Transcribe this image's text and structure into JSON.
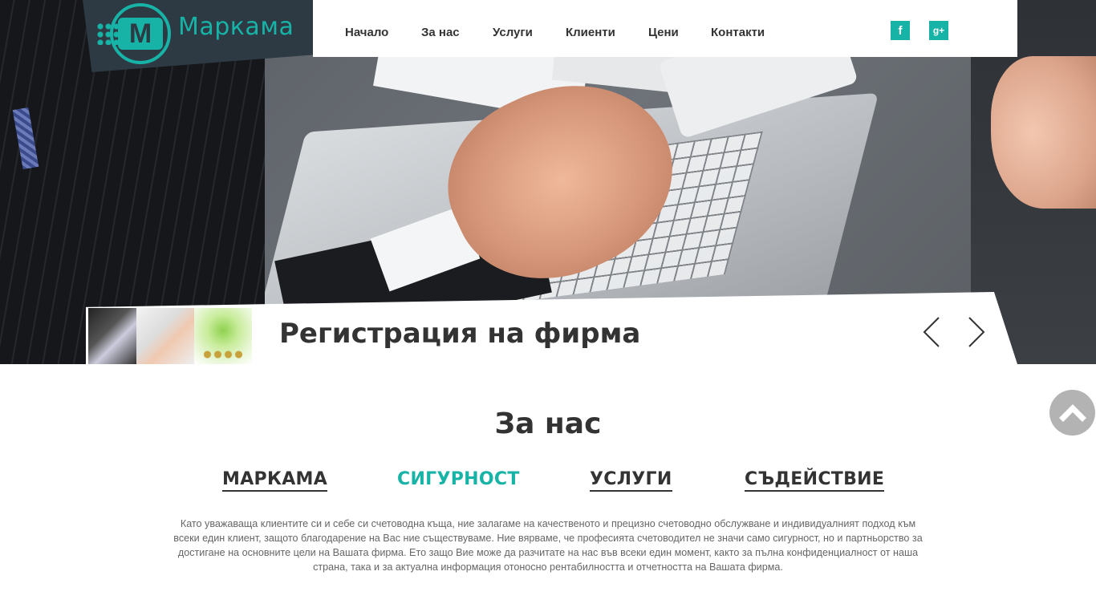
{
  "brand": {
    "name": "Маркама",
    "mark_letter": "M",
    "accent_color": "#17b3a7",
    "dark_color": "#2d3a44"
  },
  "nav": {
    "items": [
      {
        "label": "Начало"
      },
      {
        "label": "За нас"
      },
      {
        "label": "Услуги"
      },
      {
        "label": "Клиенти"
      },
      {
        "label": "Цени"
      },
      {
        "label": "Контакти"
      }
    ]
  },
  "social": {
    "facebook": {
      "icon": "facebook-icon",
      "glyph": "f"
    },
    "googleplus": {
      "icon": "google-plus-icon",
      "glyph": "g+"
    }
  },
  "slider": {
    "title": "Регистрация на фирма",
    "thumbnails": [
      "thumbnail-handshake",
      "thumbnail-documents",
      "thumbnail-plants"
    ],
    "prev_icon": "chevron-left-icon",
    "next_icon": "chevron-right-icon"
  },
  "about": {
    "title": "За нас",
    "tabs": [
      {
        "label": "МАРКАМА",
        "active": false
      },
      {
        "label": "СИГУРНОСТ",
        "active": true
      },
      {
        "label": "УСЛУГИ",
        "active": false
      },
      {
        "label": "СЪДЕЙСТВИЕ",
        "active": false
      }
    ],
    "text": "Като уважаваща клиентите си и себе си счетоводна къща, ние залагаме на качественото и прецизно счетоводно обслужване и индивидуалният подход към всеки един клиент, защото благодарение на Вас ние съществуваме. Ние вярваме, че професията счетоводител не значи само сигурност, но и партньорство за достигане на основните цели на Вашата фирма. Ето защо Вие може да разчитате на нас във всеки един момент, както за пълна конфиденциалност от наша страна, така и за актуална информация отоносно рентабилността и отчетността на Вашата фирма."
  },
  "scroll_top": {
    "icon": "chevron-up-icon"
  }
}
